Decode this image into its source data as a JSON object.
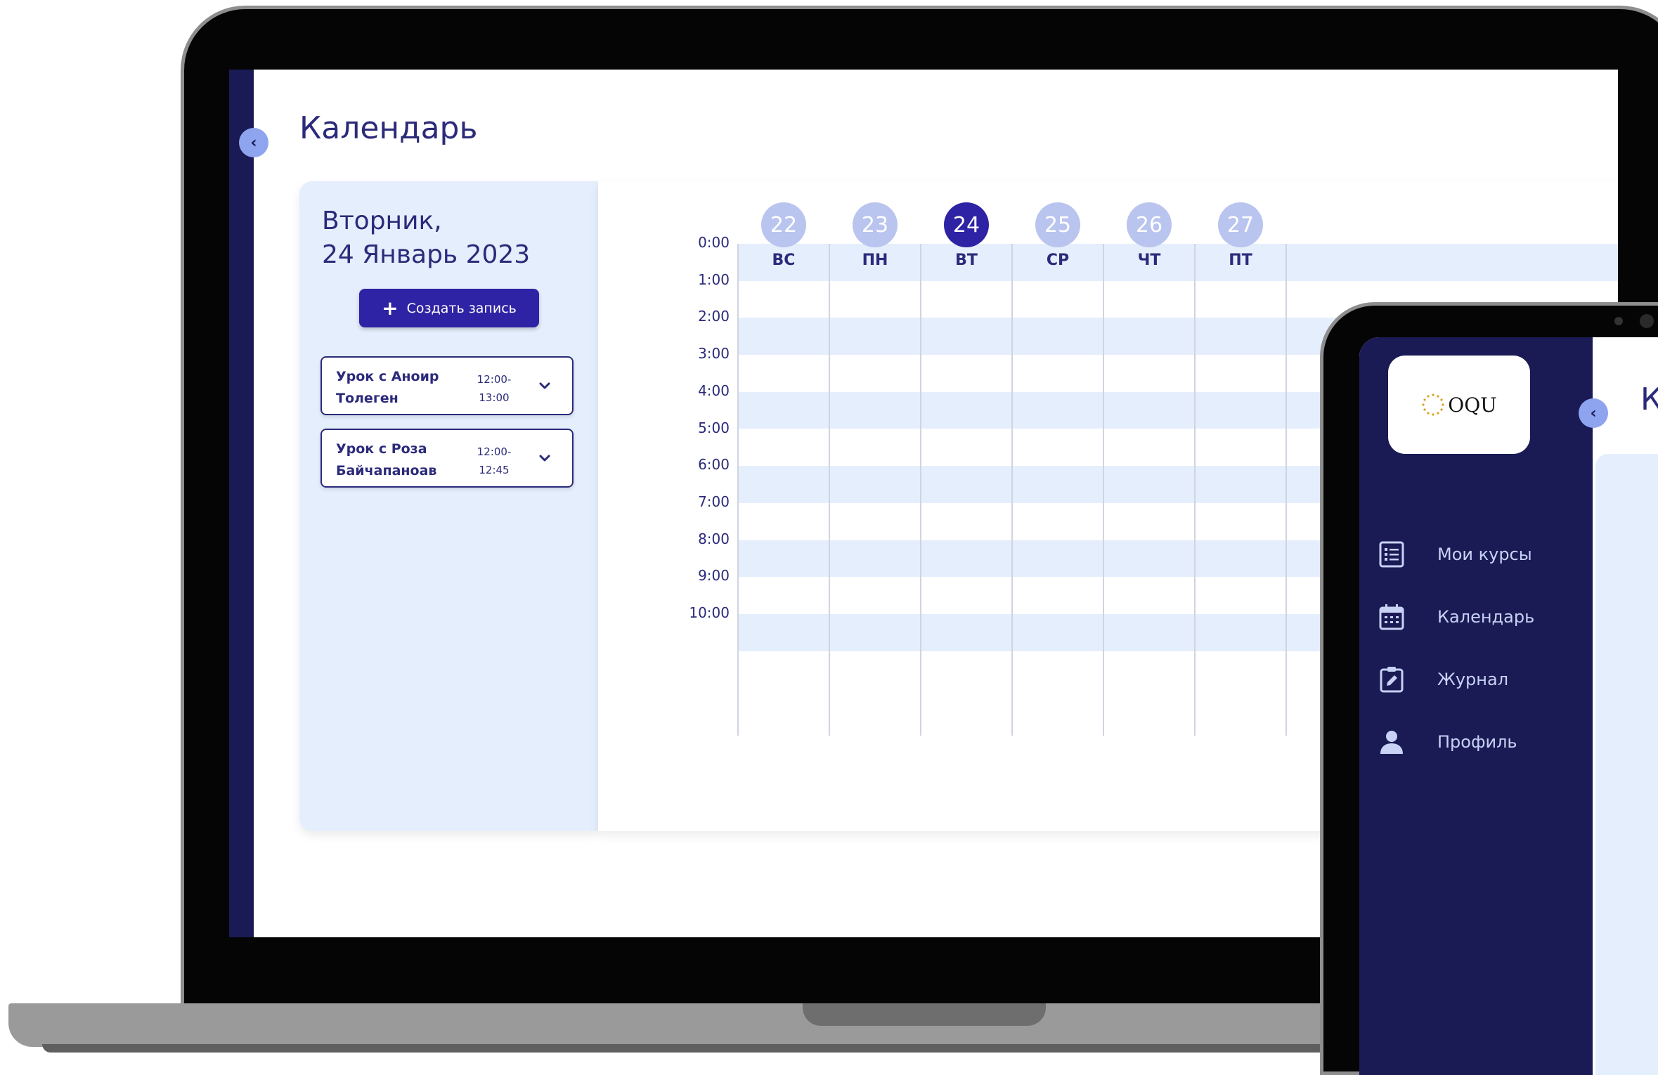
{
  "page": {
    "title": "Календарь"
  },
  "day_panel": {
    "weekday": "Вторник,",
    "date": "24 Январь 2023",
    "create_button": "Создать запись",
    "events": [
      {
        "name": "Урок с Аноир\nТолеген",
        "time": "12:00-\n13:00"
      },
      {
        "name": "Урок с Роза\nБайчапаноав",
        "time": "12:00-\n12:45"
      }
    ]
  },
  "calendar": {
    "days": [
      {
        "num": "22",
        "name": "ВС",
        "active": false
      },
      {
        "num": "23",
        "name": "ПН",
        "active": false
      },
      {
        "num": "24",
        "name": "ВТ",
        "active": true
      },
      {
        "num": "25",
        "name": "СР",
        "active": false
      },
      {
        "num": "26",
        "name": "ЧТ",
        "active": false
      },
      {
        "num": "27",
        "name": "ПТ",
        "active": false
      }
    ],
    "hours": [
      "0:00",
      "1:00",
      "2:00",
      "3:00",
      "4:00",
      "5:00",
      "6:00",
      "7:00",
      "8:00",
      "9:00",
      "10:00"
    ]
  },
  "tablet": {
    "logo": "OQU",
    "title": "К",
    "nav": [
      {
        "label": "Мои курсы",
        "icon": "list-icon"
      },
      {
        "label": "Календарь",
        "icon": "calendar-icon"
      },
      {
        "label": "Журнал",
        "icon": "clipboard-edit-icon"
      },
      {
        "label": "Профиль",
        "icon": "user-icon"
      }
    ]
  },
  "colors": {
    "sidebar": "#1a1a54",
    "primary": "#2e23a4",
    "panel": "#e5eefc",
    "inactive_day": "#b9c4ef",
    "collapse_button": "#8ea4ef"
  }
}
